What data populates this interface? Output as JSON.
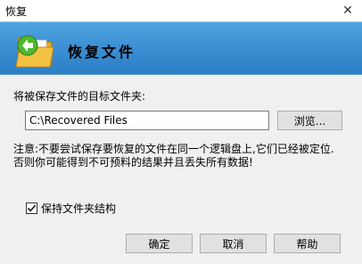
{
  "window": {
    "title": "恢复",
    "close_icon": "close-icon"
  },
  "banner": {
    "title": "恢复文件",
    "icon": "folder-recover-icon"
  },
  "form": {
    "folder_label": "将被保存文件的目标文件夹:",
    "path_value": "C:\\Recovered Files",
    "browse_label": "浏览...",
    "warning": "注意:不要尝试保存要恢复的文件在同一个逻辑盘上,它们已经被定位.否则你可能得到不可预料的结果并且丢失所有数据!",
    "keep_structure_label": "保持文件夹结构",
    "keep_structure_checked": true
  },
  "buttons": {
    "ok": "确定",
    "cancel": "取消",
    "help": "帮助"
  },
  "colors": {
    "banner_top": "#4fa4df",
    "banner_bottom": "#2d7fc7",
    "folder": "#f3c244",
    "arrow": "#4fb82f"
  }
}
